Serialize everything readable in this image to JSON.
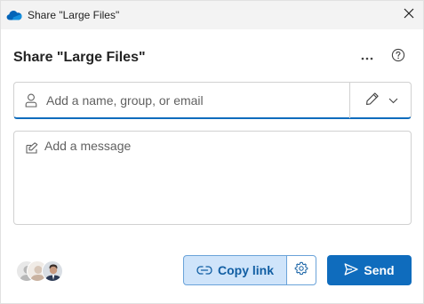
{
  "window": {
    "title": "Share \"Large Files\"",
    "app_icon": "onedrive-cloud-icon",
    "close_icon": "close-icon"
  },
  "dialog": {
    "heading": "Share \"Large Files\"",
    "more_icon": "more-options-icon",
    "help_icon": "help-icon"
  },
  "recipients": {
    "placeholder": "Add a name, group, or email",
    "value": "",
    "icon": "person-icon",
    "permission_icon": "pencil-edit-icon",
    "dropdown_icon": "chevron-down-icon"
  },
  "message": {
    "placeholder": "Add a message",
    "value": "",
    "icon": "message-compose-icon"
  },
  "footer": {
    "avatars": [
      "avatar-generic-1",
      "avatar-generic-2",
      "avatar-photo-3"
    ],
    "copy_link_label": "Copy link",
    "copy_link_icon": "link-icon",
    "link_settings_icon": "gear-icon",
    "send_label": "Send",
    "send_icon": "send-icon"
  },
  "colors": {
    "accent": "#0f6cbd",
    "copy_link_bg": "#cfe4fa",
    "copy_link_text": "#115ea3",
    "titlebar_bg": "#f3f3f3"
  }
}
